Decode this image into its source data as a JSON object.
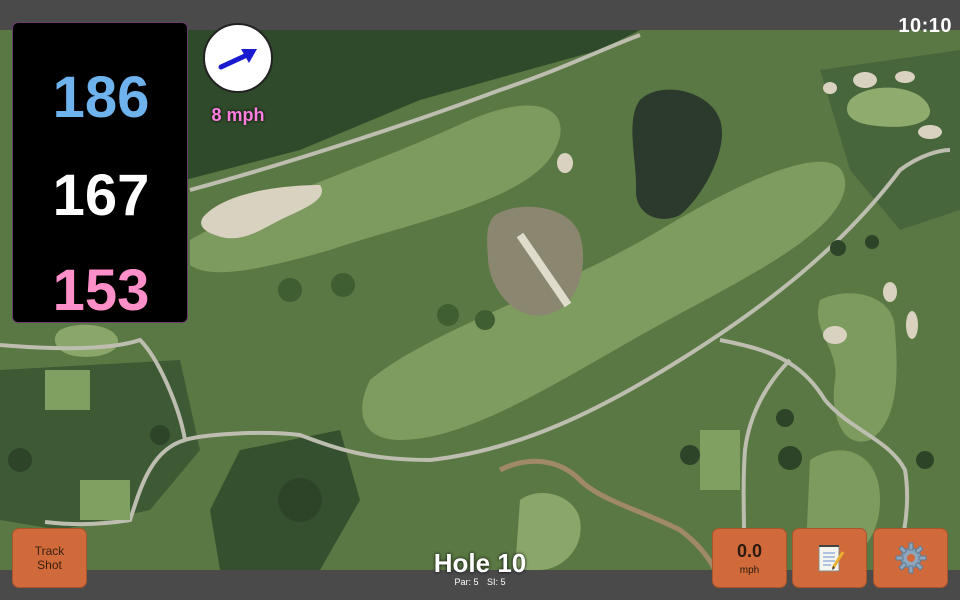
{
  "status_bar": {
    "time": "10:10"
  },
  "distances": {
    "back": "186",
    "middle": "167",
    "front": "153"
  },
  "wind": {
    "speed": "8 mph",
    "icon": "wind-arrow-icon"
  },
  "hole": {
    "title": "Hole 10",
    "par_label": "Par: 5",
    "si_label": "SI: 5"
  },
  "buttons": {
    "track_shot": {
      "line1": "Track",
      "line2": "Shot"
    },
    "speed": {
      "value": "0.0",
      "unit": "mph"
    },
    "notes": {
      "icon": "notepad-icon"
    },
    "settings": {
      "icon": "gear-icon"
    }
  },
  "colors": {
    "back": "#6fb3ee",
    "middle": "#ffffff",
    "front": "#ff8fc8",
    "button": "#d06a3a",
    "wind_text": "#ff7ee0"
  }
}
